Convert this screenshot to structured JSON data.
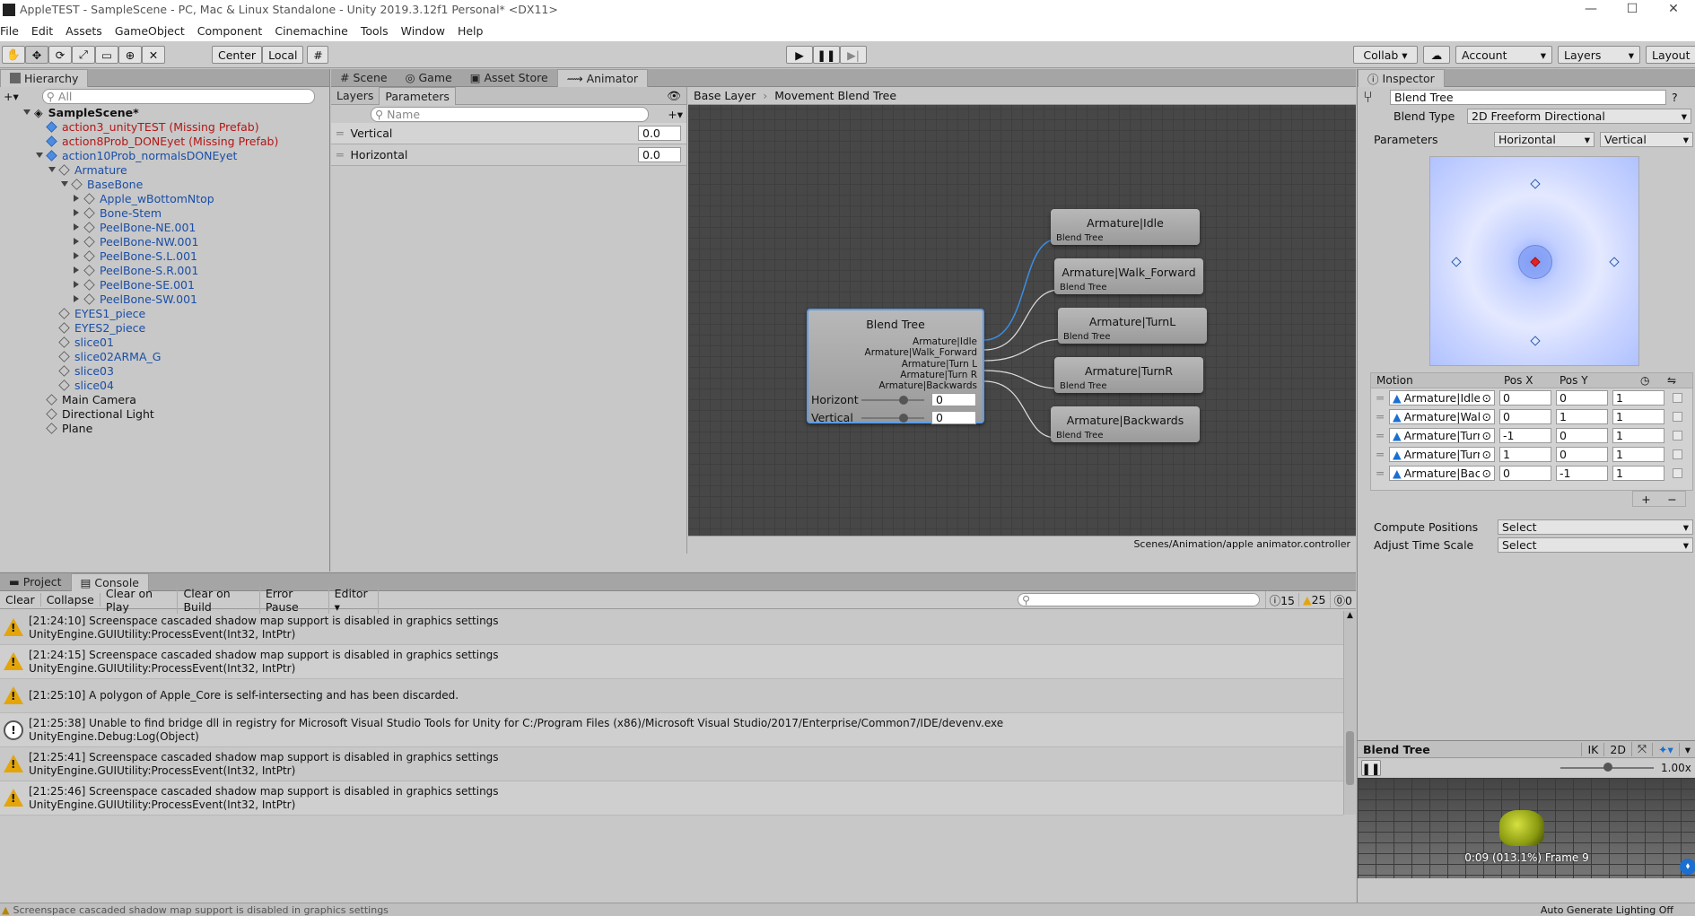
{
  "window": {
    "title": "AppleTEST - SampleScene - PC, Mac & Linux Standalone - Unity 2019.3.12f1 Personal* <DX11>",
    "min": "—",
    "max": "☐",
    "close": "✕"
  },
  "menu": [
    "File",
    "Edit",
    "Assets",
    "GameObject",
    "Component",
    "Cinemachine",
    "Tools",
    "Window",
    "Help"
  ],
  "toolbar": {
    "center": "Center",
    "local": "Local",
    "collab": "Collab ▾",
    "account": "Account",
    "layers": "Layers",
    "layout": "Layout"
  },
  "hierarchy": {
    "tab": "Hierarchy",
    "search_placeholder": "All",
    "scene": "SampleScene*",
    "items": [
      {
        "label": "action3_unityTEST (Missing Prefab)",
        "style": "red",
        "indent": 0,
        "arrow": "none",
        "icon": "blue"
      },
      {
        "label": "action8Prob_DONEyet (Missing Prefab)",
        "style": "red",
        "indent": 0,
        "arrow": "none",
        "icon": "blue"
      },
      {
        "label": "action10Prob_normalsDONEyet",
        "style": "blue",
        "indent": 0,
        "arrow": "down",
        "icon": "blue"
      },
      {
        "label": "Armature",
        "style": "blue",
        "indent": 1,
        "arrow": "down",
        "icon": "gray"
      },
      {
        "label": "BaseBone",
        "style": "blue",
        "indent": 2,
        "arrow": "down",
        "icon": "gray"
      },
      {
        "label": "Apple_wBottomNtop",
        "style": "blue",
        "indent": 3,
        "arrow": "right",
        "icon": "gray"
      },
      {
        "label": "Bone-Stem",
        "style": "blue",
        "indent": 3,
        "arrow": "right",
        "icon": "gray"
      },
      {
        "label": "PeelBone-NE.001",
        "style": "blue",
        "indent": 3,
        "arrow": "right",
        "icon": "gray"
      },
      {
        "label": "PeelBone-NW.001",
        "style": "blue",
        "indent": 3,
        "arrow": "right",
        "icon": "gray"
      },
      {
        "label": "PeelBone-S.L.001",
        "style": "blue",
        "indent": 3,
        "arrow": "right",
        "icon": "gray"
      },
      {
        "label": "PeelBone-S.R.001",
        "style": "blue",
        "indent": 3,
        "arrow": "right",
        "icon": "gray"
      },
      {
        "label": "PeelBone-SE.001",
        "style": "blue",
        "indent": 3,
        "arrow": "right",
        "icon": "gray"
      },
      {
        "label": "PeelBone-SW.001",
        "style": "blue",
        "indent": 3,
        "arrow": "right",
        "icon": "gray"
      },
      {
        "label": "EYES1_piece",
        "style": "blue",
        "indent": 1,
        "arrow": "none",
        "icon": "gray"
      },
      {
        "label": "EYES2_piece",
        "style": "blue",
        "indent": 1,
        "arrow": "none",
        "icon": "gray"
      },
      {
        "label": "slice01",
        "style": "blue",
        "indent": 1,
        "arrow": "none",
        "icon": "gray"
      },
      {
        "label": "slice02ARMA_G",
        "style": "blue",
        "indent": 1,
        "arrow": "none",
        "icon": "gray"
      },
      {
        "label": "slice03",
        "style": "blue",
        "indent": 1,
        "arrow": "none",
        "icon": "gray"
      },
      {
        "label": "slice04",
        "style": "blue",
        "indent": 1,
        "arrow": "none",
        "icon": "gray"
      },
      {
        "label": "Main Camera",
        "style": "normal",
        "indent": 0,
        "arrow": "none",
        "icon": "gray"
      },
      {
        "label": "Directional Light",
        "style": "normal",
        "indent": 0,
        "arrow": "none",
        "icon": "gray"
      },
      {
        "label": "Plane",
        "style": "normal",
        "indent": 0,
        "arrow": "none",
        "icon": "gray"
      }
    ]
  },
  "center_tabs": [
    "Scene",
    "Game",
    "Asset Store",
    "Animator"
  ],
  "animator": {
    "layers_tab": "Layers",
    "params_tab": "Parameters",
    "search_placeholder": "Name",
    "params": [
      {
        "name": "Vertical",
        "value": "0.0"
      },
      {
        "name": "Horizontal",
        "value": "0.0"
      }
    ],
    "breadcrumb": [
      "Base Layer",
      "Movement Blend Tree"
    ],
    "path": "Scenes/Animation/apple animator.controller",
    "blend_node": {
      "title": "Blend Tree",
      "outputs": [
        "Armature|Idle",
        "Armature|Walk_Forward",
        "Armature|Turn L",
        "Armature|Turn R",
        "Armature|Backwards"
      ],
      "horiz_label": "Horizont",
      "vert_label": "Vertical",
      "horiz_value": "0",
      "vert_value": "0"
    },
    "clips": [
      {
        "title": "Armature|Idle",
        "sub": "Blend Tree"
      },
      {
        "title": "Armature|Walk_Forward",
        "sub": "Blend Tree"
      },
      {
        "title": "Armature|TurnL",
        "sub": "Blend Tree"
      },
      {
        "title": "Armature|TurnR",
        "sub": "Blend Tree"
      },
      {
        "title": "Armature|Backwards",
        "sub": "Blend Tree"
      }
    ]
  },
  "inspector": {
    "tab": "Inspector",
    "name": "Blend Tree",
    "blend_type_label": "Blend Type",
    "blend_type": "2D Freeform Directional",
    "parameters_label": "Parameters",
    "param_x": "Horizontal",
    "param_y": "Vertical",
    "headers": {
      "motion": "Motion",
      "posx": "Pos X",
      "posy": "Pos Y"
    },
    "motions": [
      {
        "name": "Armature|Idle",
        "x": "0",
        "y": "0",
        "speed": "1"
      },
      {
        "name": "Armature|Walk",
        "x": "0",
        "y": "1",
        "speed": "1"
      },
      {
        "name": "Armature|Turn",
        "x": "-1",
        "y": "0",
        "speed": "1"
      },
      {
        "name": "Armature|Turn",
        "x": "1",
        "y": "0",
        "speed": "1"
      },
      {
        "name": "Armature|Back",
        "x": "0",
        "y": "-1",
        "speed": "1"
      }
    ],
    "compute_label": "Compute Positions",
    "compute_value": "Select",
    "adjust_label": "Adjust Time Scale",
    "adjust_value": "Select",
    "preview_title": "Blend Tree",
    "ik": "IK",
    "twod": "2D",
    "speed": "1.00x",
    "frame": "0:09 (013.1%) Frame 9"
  },
  "console": {
    "project_tab": "Project",
    "console_tab": "Console",
    "clear": "Clear",
    "collapse": "Collapse",
    "clear_on_play": "Clear on Play",
    "clear_on_build": "Clear on Build",
    "error_pause": "Error Pause",
    "editor": "Editor",
    "count_info": "15",
    "count_warn": "25",
    "count_err": "0",
    "messages": [
      {
        "type": "warn",
        "line1": "[21:24:10] Screenspace cascaded shadow map support is disabled in graphics settings",
        "line2": "UnityEngine.GUIUtility:ProcessEvent(Int32, IntPtr)"
      },
      {
        "type": "warn",
        "line1": "[21:24:15] Screenspace cascaded shadow map support is disabled in graphics settings",
        "line2": "UnityEngine.GUIUtility:ProcessEvent(Int32, IntPtr)"
      },
      {
        "type": "warn",
        "line1": "[21:25:10] A polygon of Apple_Core is self-intersecting and has been discarded.",
        "line2": ""
      },
      {
        "type": "info",
        "line1": "[21:25:38] Unable to find bridge dll in registry for Microsoft Visual Studio Tools for Unity for C:/Program Files (x86)/Microsoft Visual Studio/2017/Enterprise/Common7/IDE/devenv.exe",
        "line2": "UnityEngine.Debug:Log(Object)"
      },
      {
        "type": "warn",
        "line1": "[21:25:41] Screenspace cascaded shadow map support is disabled in graphics settings",
        "line2": "UnityEngine.GUIUtility:ProcessEvent(Int32, IntPtr)"
      },
      {
        "type": "warn",
        "line1": "[21:25:46] Screenspace cascaded shadow map support is disabled in graphics settings",
        "line2": "UnityEngine.GUIUtility:ProcessEvent(Int32, IntPtr)"
      }
    ]
  },
  "statusbar": {
    "message": "Screenspace cascaded shadow map support is disabled in graphics settings",
    "right": "Auto Generate Lighting Off"
  },
  "colors": {
    "graph_bg": "#474747",
    "link": "#3b8ee0",
    "warn": "#e4a50a"
  }
}
